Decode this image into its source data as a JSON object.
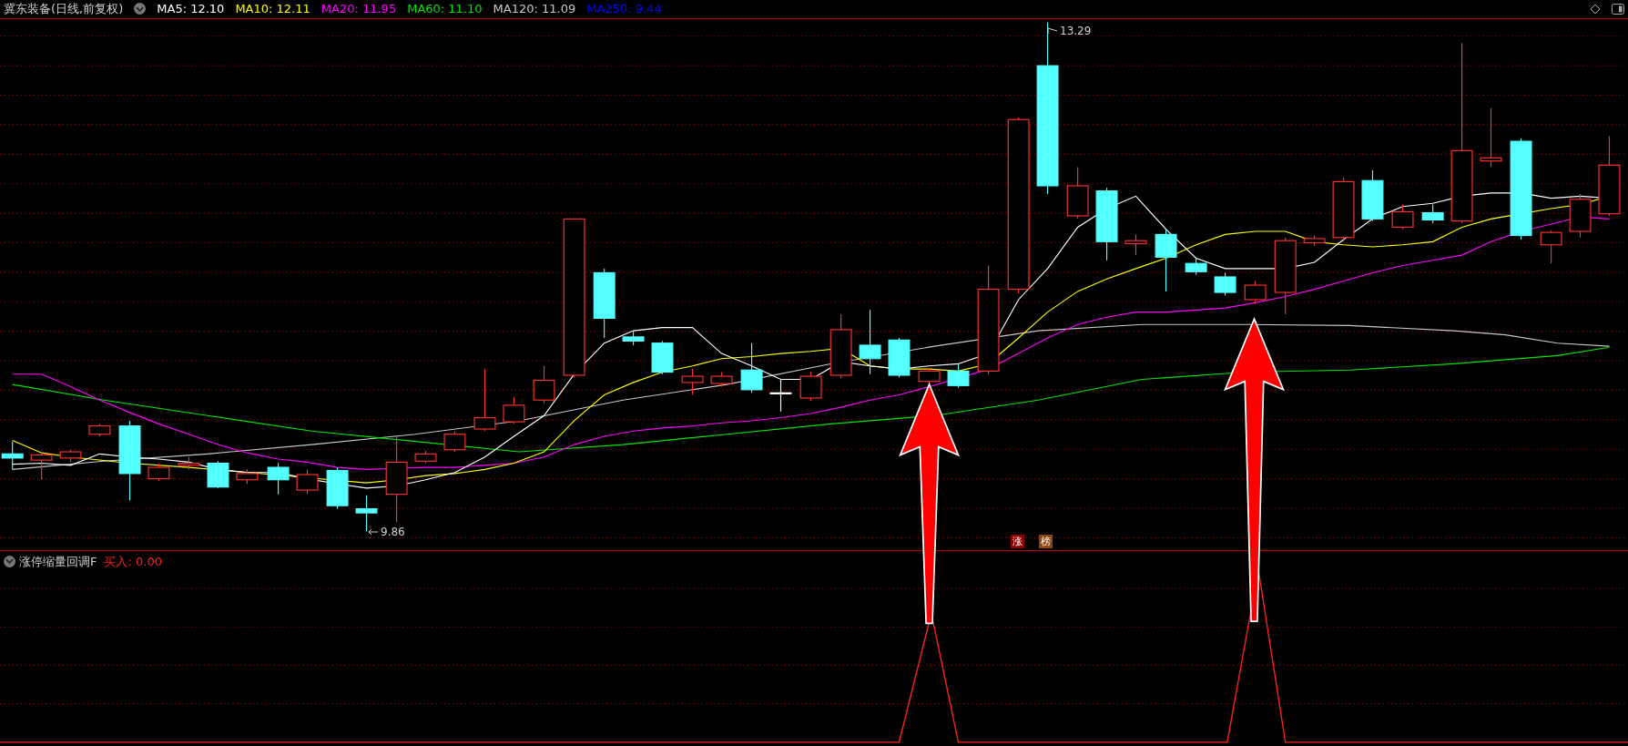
{
  "header": {
    "title": "冀东装备(日线,前复权)",
    "moving_averages": [
      {
        "label": "MA5: 12.10",
        "color": "#ffffff"
      },
      {
        "label": "MA10: 12.11",
        "color": "#ffff00"
      },
      {
        "label": "MA20: 11.95",
        "color": "#ff00ff"
      },
      {
        "label": "MA60: 11.10",
        "color": "#00e600"
      },
      {
        "label": "MA120: 11.09",
        "color": "#c8c8c8"
      },
      {
        "label": "MA250: 9.44",
        "color": "#0000ff"
      }
    ]
  },
  "price_chart": {
    "high_label": "13.29",
    "low_label": "9.86",
    "badges": [
      {
        "label": "涨",
        "color": "#8b0000"
      },
      {
        "label": "榜",
        "color": "#8b4513"
      }
    ]
  },
  "indicator_panel": {
    "title": "涨停缩量回调F",
    "readout": "买入: 0.00"
  }
}
